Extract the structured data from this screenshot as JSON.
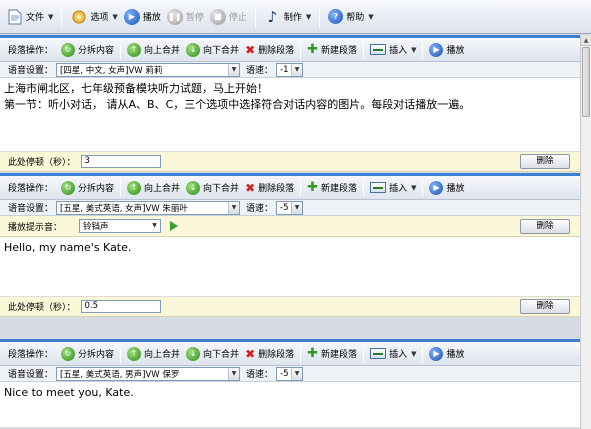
{
  "toolbar": {
    "file": "文件",
    "options": "选项",
    "play": "播放",
    "pause": "暂停",
    "stop": "停止",
    "make": "制作",
    "help": "帮助"
  },
  "para_toolbar": {
    "label": "段落操作：",
    "split": "分拆内容",
    "merge_up": "向上合并",
    "merge_down": "向下合并",
    "delete_para": "删除段落",
    "new_para": "新建段落",
    "insert": "插入",
    "play": "播放"
  },
  "labels": {
    "voice": "语音设置：",
    "speed": "语速：",
    "pause": "此处停顿（秒）：",
    "prompt": "播放提示音：",
    "delete": "删除"
  },
  "blocks": [
    {
      "voice": "[四星, 中文, 女声]VW 莉莉",
      "speed": "-1",
      "lines": [
        "上海市闸北区，七年级预备模块听力试题，马上开始！",
        "第一节：听小对话， 请从A、B、C，三个选项中选择符合对话内容的图片。每段对话播放一遍。"
      ],
      "pause": "3"
    },
    {
      "voice": "[五星, 美式英语, 女声]VW 朱丽叶",
      "speed": "-5",
      "prompt_sound": "铃铛声",
      "lines": [
        "Hello, my name's Kate."
      ],
      "pause": "0.5"
    },
    {
      "voice": "[五星, 美式英语, 男声]VW 保罗",
      "speed": "-5",
      "lines": [
        "Nice to meet you, Kate."
      ]
    }
  ]
}
